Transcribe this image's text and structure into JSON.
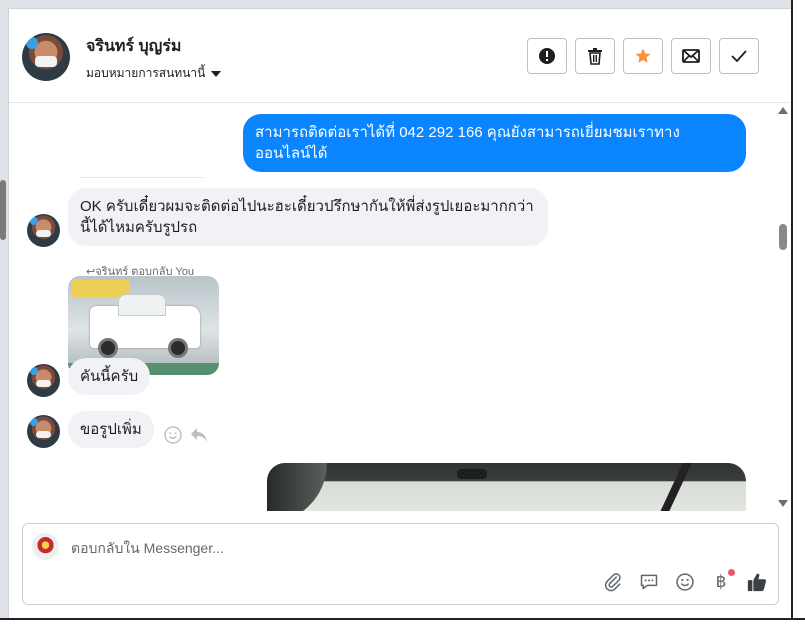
{
  "header": {
    "name": "จรินทร์ บุญร่ม",
    "assign_label": "มอบหมายการสนทนานี้",
    "actions": [
      {
        "icon": "alert-icon"
      },
      {
        "icon": "trash-icon"
      },
      {
        "icon": "star-icon"
      },
      {
        "icon": "envelope-icon"
      },
      {
        "icon": "check-icon"
      }
    ],
    "star_color": "#f7923a"
  },
  "messages": {
    "outgoing_1": "สามารถติดต่อเราได้ที่ 042 292 166 คุณยังสามารถเยี่ยมชมเราทางออนไลน์ได้",
    "incoming_1": "OK ครับเดี๋ยวผมจะติดต่อไปนะฮะเดี๋ยวปรึกษากันให้พี่ส่งรูปเยอะมากกว่านี้ได้ไหมครับรูปรถ",
    "reply_label": "↩จรินทร์ ตอบกลับ You",
    "incoming_2": "คันนี้ครับ",
    "incoming_3": "ขอรูปเพิ่ม"
  },
  "composer": {
    "placeholder": "ตอบกลับใน Messenger...",
    "baht_symbol": "฿"
  },
  "colors": {
    "outgoing_bubble": "#0a84ff",
    "incoming_bubble": "#f0f2f5",
    "accent_like": "#606770"
  }
}
